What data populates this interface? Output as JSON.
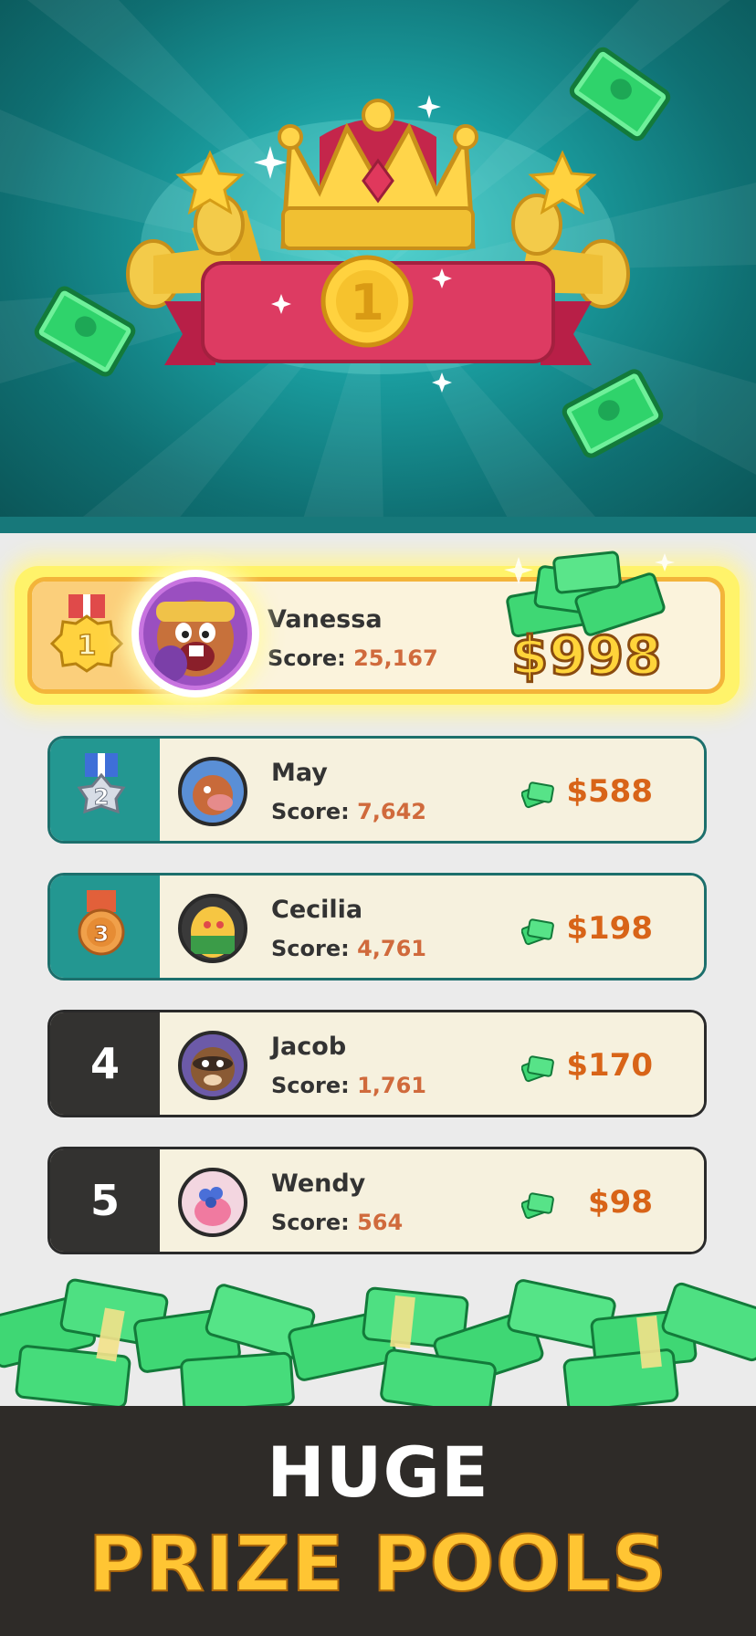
{
  "leaderboard": [
    {
      "rank": "1",
      "name": "Vanessa",
      "score_label": "Score:",
      "score": "25,167",
      "prize": "$998"
    },
    {
      "rank": "2",
      "name": "May",
      "score_label": "Score:",
      "score": "7,642",
      "prize": "$588"
    },
    {
      "rank": "3",
      "name": "Cecilia",
      "score_label": "Score:",
      "score": "4,761",
      "prize": "$198"
    },
    {
      "rank": "4",
      "name": "Jacob",
      "score_label": "Score:",
      "score": "1,761",
      "prize": "$170"
    },
    {
      "rank": "5",
      "name": "Wendy",
      "score_label": "Score:",
      "score": "564",
      "prize": "$98"
    }
  ],
  "banner": {
    "badge_number": "1"
  },
  "footer": {
    "line1": "HUGE",
    "line2": "PRIZE POOLS"
  },
  "colors": {
    "teal": "#239791",
    "gold": "#ffc533",
    "prize_orange": "#d86418",
    "dark": "#2e2b28"
  }
}
